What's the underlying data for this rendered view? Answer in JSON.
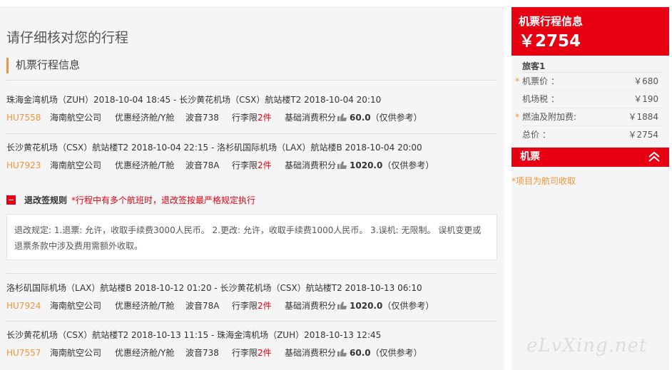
{
  "page": {
    "title": "请仔细核对您的行程",
    "section_title": "机票行程信息"
  },
  "segments": [
    {
      "route": "珠海金湾机场（ZUH）2018-10-04 18:45 - 长沙黄花机场（CSX）航站楼T2 2018-10-04 20:10",
      "flight_no": "HU7558",
      "airline": "海南航空公司",
      "cabin": "优惠经济舱/Y舱",
      "aircraft": "波音738",
      "baggage_label": "行李限",
      "baggage_value": "2件",
      "points_label": "基础消费积分",
      "points_value": "60.0",
      "points_note": "（仅供参考）"
    },
    {
      "route": "长沙黄花机场（CSX）航站楼T2 2018-10-04 22:15 - 洛杉矶国际机场（LAX）航站楼B 2018-10-04 20:00",
      "flight_no": "HU7923",
      "airline": "海南航空公司",
      "cabin": "优惠经济舱/T舱",
      "aircraft": "波音78A",
      "baggage_label": "行李限",
      "baggage_value": "2件",
      "points_label": "基础消费积分",
      "points_value": "1020.0",
      "points_note": "（仅供参考）"
    },
    {
      "route": "洛杉矶国际机场（LAX）航站楼B 2018-10-12 01:20 - 长沙黄花机场（CSX）航站楼T2 2018-10-13 06:10",
      "flight_no": "HU7924",
      "airline": "海南航空公司",
      "cabin": "优惠经济舱/T舱",
      "aircraft": "波音78A",
      "baggage_label": "行李限",
      "baggage_value": "2件",
      "points_label": "基础消费积分",
      "points_value": "1020.0",
      "points_note": "（仅供参考）"
    },
    {
      "route": "长沙黄花机场（CSX）航站楼T2 2018-10-13 11:15 - 珠海金湾机场（ZUH）2018-10-13 12:45",
      "flight_no": "HU7557",
      "airline": "海南航空公司",
      "cabin": "优惠经济舱/Y舱",
      "aircraft": "波音738",
      "baggage_label": "行李限",
      "baggage_value": "2件",
      "points_label": "基础消费积分",
      "points_value": "60.0",
      "points_note": "（仅供参考）"
    }
  ],
  "refund": {
    "label": "退改签规则",
    "warning": "*行程中有多个航班时，退改签按最严格规定执行",
    "text": "退改规定: 1.退票: 允许，收取手续费3000人民币。 2.更改: 允许，收取手续费1000人民币。 3.误机: 无限制。 误机变更或退票条款中涉及费用需额外收取。"
  },
  "sidebar": {
    "header_title": "机票行程信息",
    "total_price": "￥2754",
    "passenger": "旅客1",
    "fees": [
      {
        "label": "机票价 ：",
        "value": "￥680",
        "starred": true
      },
      {
        "label": "机场税 ：",
        "value": "￥190",
        "starred": false
      },
      {
        "label": "燃油及附加费:",
        "value": "￥1884",
        "starred": true
      },
      {
        "label": "总价 ：",
        "value": "￥2754",
        "starred": false
      }
    ],
    "ticket_bar_label": "机票",
    "note": "*项目为航司收取"
  },
  "watermark": "eLvXing.net",
  "colors": {
    "accent_red": "#e60012",
    "accent_orange": "#f29339",
    "panel_bg": "#f5f5f5"
  },
  "icons": {
    "points": "points-hand-icon",
    "collapse": "minus-square-icon",
    "ticket_toggle": "double-chevron-up-icon"
  }
}
